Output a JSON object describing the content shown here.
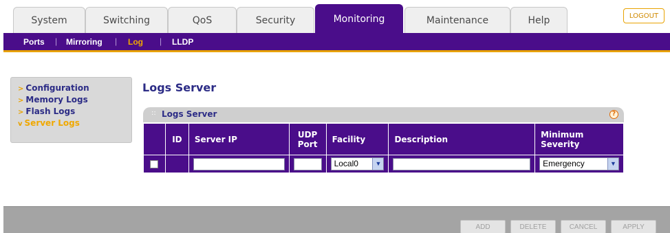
{
  "tabs": [
    {
      "label": "System",
      "active": false
    },
    {
      "label": "Switching",
      "active": false
    },
    {
      "label": "QoS",
      "active": false
    },
    {
      "label": "Security",
      "active": false
    },
    {
      "label": "Monitoring",
      "active": true
    },
    {
      "label": "Maintenance",
      "active": false
    },
    {
      "label": "Help",
      "active": false
    }
  ],
  "logout_label": "LOGOUT",
  "subnav": [
    {
      "label": "Ports",
      "active": false
    },
    {
      "label": "Mirroring",
      "active": false
    },
    {
      "label": "Log",
      "active": true
    },
    {
      "label": "LLDP",
      "active": false
    }
  ],
  "sidemenu": [
    {
      "label": "Configuration",
      "mark": ">",
      "active": false
    },
    {
      "label": "Memory Logs",
      "mark": ">",
      "active": false
    },
    {
      "label": "Flash Logs",
      "mark": ">",
      "active": false
    },
    {
      "label": "Server Logs",
      "mark": "v",
      "active": true
    }
  ],
  "page_title": "Logs Server",
  "panel": {
    "title": "Logs Server",
    "help_glyph": "?",
    "columns": {
      "id": "ID",
      "server_ip": "Server IP",
      "udp_port": "UDP Port",
      "facility": "Facility",
      "description": "Description",
      "min_severity": "Minimum Severity"
    },
    "row": {
      "server_ip": "",
      "udp_port": "",
      "facility": "Local0",
      "description": "",
      "min_severity": "Emergency"
    }
  },
  "footer_buttons": {
    "add": "ADD",
    "delete": "DELETE",
    "cancel": "CANCEL",
    "apply": "APPLY"
  },
  "colors": {
    "brand_purple": "#4a0d8a",
    "accent_orange": "#e8a200",
    "link_blue": "#2c2c86"
  }
}
